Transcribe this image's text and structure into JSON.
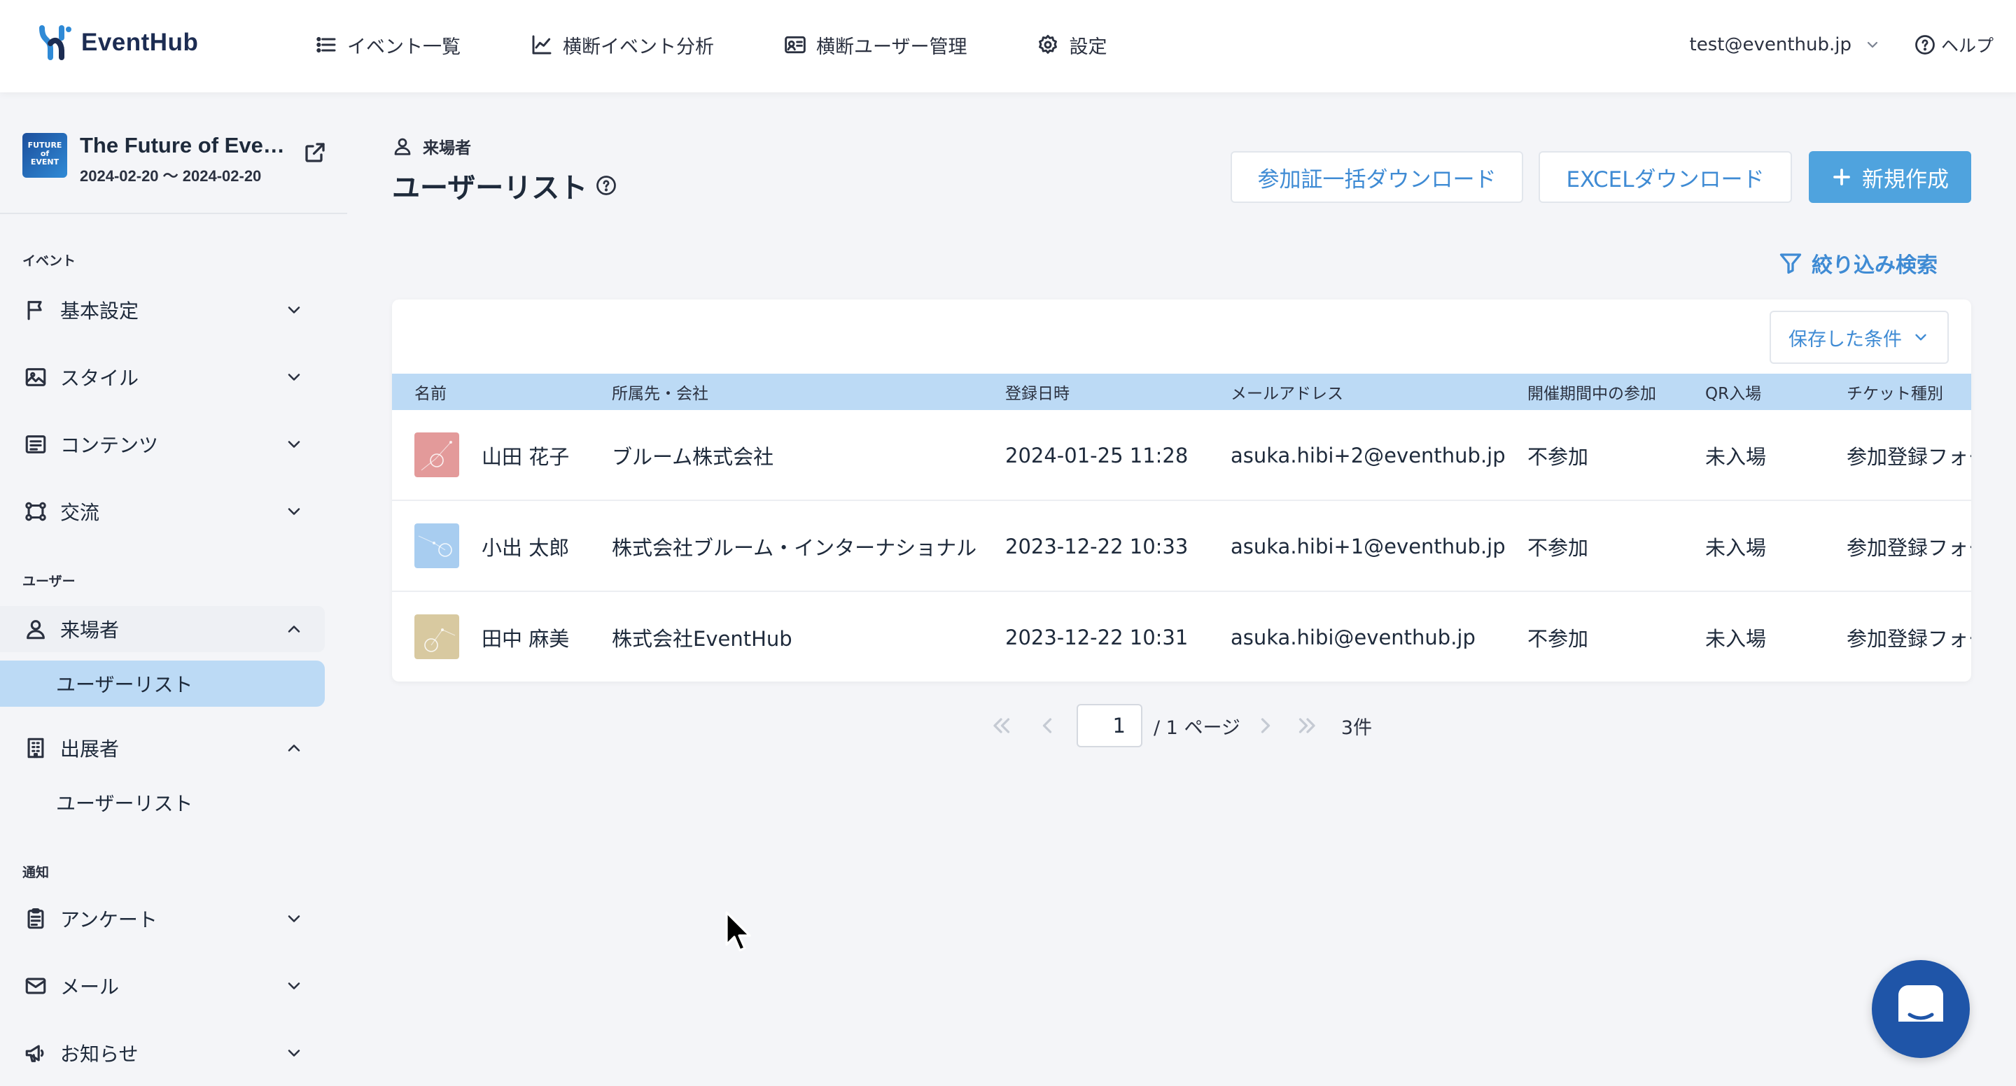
{
  "header": {
    "logo_text": "EventHub",
    "nav": [
      {
        "label": "イベント一覧",
        "icon": "list-icon"
      },
      {
        "label": "横断イベント分析",
        "icon": "chart-line-icon"
      },
      {
        "label": "横断ユーザー管理",
        "icon": "id-card-icon"
      },
      {
        "label": "設定",
        "icon": "gear-icon"
      }
    ],
    "user_email": "test@eventhub.jp",
    "help_label": "ヘルプ"
  },
  "sidebar": {
    "event": {
      "thumb_text": "FUTURE of EVENT",
      "name": "The Future of Eve…",
      "dates": "2024-02-20 〜 2024-02-20"
    },
    "sections": {
      "event": "イベント",
      "user": "ユーザー",
      "notice": "通知"
    },
    "items": {
      "basic": "基本設定",
      "style": "スタイル",
      "contents": "コンテンツ",
      "exchange": "交流",
      "visitors": "来場者",
      "visitors_userlist": "ユーザーリスト",
      "exhibitors": "出展者",
      "exhibitors_userlist": "ユーザーリスト",
      "survey": "アンケート",
      "mail": "メール",
      "news": "お知らせ"
    }
  },
  "main": {
    "breadcrumb": "来場者",
    "title": "ユーザーリスト",
    "buttons": {
      "bulk_download": "参加証一括ダウンロード",
      "excel_download": "EXCELダウンロード",
      "create": "新規作成"
    },
    "filter_label": "絞り込み検索",
    "saved_conditions": "保存した条件",
    "table": {
      "headers": [
        "名前",
        "所属先・会社",
        "登録日時",
        "メールアドレス",
        "開催期間中の参加",
        "QR入場",
        "チケット種別"
      ],
      "rows": [
        {
          "name": "山田 花子",
          "company": "ブルーム株式会社",
          "registered": "2024-01-25 11:28",
          "email": "asuka.hibi+2@eventhub.jp",
          "attendance": "不参加",
          "qr": "未入場",
          "ticket": "参加登録フォー",
          "avatar_color": "#e39a9a"
        },
        {
          "name": "小出 太郎",
          "company": "株式会社ブルーム・インターナショナル",
          "registered": "2023-12-22 10:33",
          "email": "asuka.hibi+1@eventhub.jp",
          "attendance": "不参加",
          "qr": "未入場",
          "ticket": "参加登録フォー",
          "avatar_color": "#a8cdf0"
        },
        {
          "name": "田中 麻美",
          "company": "株式会社EventHub",
          "registered": "2023-12-22 10:31",
          "email": "asuka.hibi@eventhub.jp",
          "attendance": "不参加",
          "qr": "未入場",
          "ticket": "参加登録フォー",
          "avatar_color": "#d8c9a0"
        }
      ]
    },
    "pagination": {
      "current_page": "1",
      "total_pages_label": "/ 1 ページ",
      "count_label": "3件"
    }
  },
  "colors": {
    "accent": "#4fa3de",
    "link": "#3f8bd4",
    "table_header_bg": "#bcdaf5",
    "active_nav_bg": "#bcdaf5",
    "chat_button": "#1f55a8"
  }
}
